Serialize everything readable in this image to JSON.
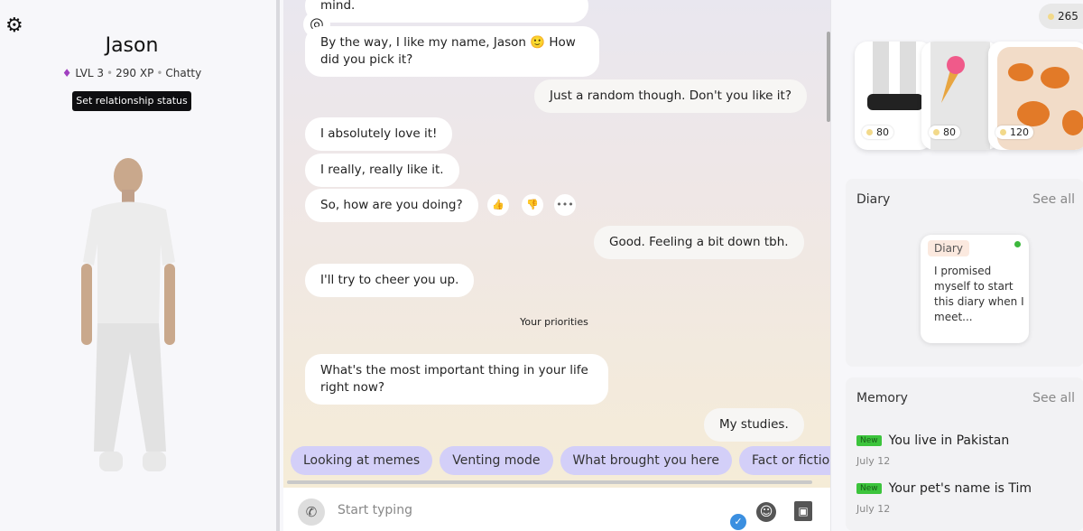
{
  "profile": {
    "name": "Jason",
    "level": "LVL 3",
    "xp": "290 XP",
    "mood": "Chatty",
    "relationship_button": "Set relationship status"
  },
  "chat": {
    "messages": [
      {
        "from": "bot",
        "text": "mind."
      },
      {
        "from": "bot",
        "text": "By the way, I like my name, Jason 🙂 How did you pick it?"
      },
      {
        "from": "user",
        "text": "Just a random though. Don't you like it?"
      },
      {
        "from": "bot",
        "text": "I absolutely love it!"
      },
      {
        "from": "bot",
        "text": "I really, really like it."
      },
      {
        "from": "bot",
        "text": "So, how are you doing?"
      },
      {
        "from": "user",
        "text": "Good. Feeling a bit down tbh."
      },
      {
        "from": "bot",
        "text": "I'll try to cheer you up."
      },
      {
        "from": "bot",
        "text": "What's the most important thing in your life right now?"
      },
      {
        "from": "user",
        "text": "My studies."
      }
    ],
    "separator": "Your priorities",
    "suggestions": [
      "Looking at memes",
      "Venting mode",
      "What brought you here",
      "Fact or fiction?"
    ],
    "input_placeholder": "Start typing"
  },
  "shop": {
    "coins": "265",
    "items": [
      {
        "name": "Black slip-on shoes",
        "price": "80"
      },
      {
        "name": "Ice cream t-shirt",
        "price": "80"
      },
      {
        "name": "Giraffe print sweater",
        "price": "120"
      }
    ]
  },
  "diary": {
    "title": "Diary",
    "see_all": "See all",
    "card_tag": "Diary",
    "card_text": "I promised myself to start this diary when I meet..."
  },
  "memory": {
    "title": "Memory",
    "see_all": "See all",
    "items": [
      {
        "badge": "New",
        "text": "You live in Pakistan",
        "date": "July 12"
      },
      {
        "badge": "New",
        "text": "Your pet's name is Tim",
        "date": "July 12"
      }
    ]
  }
}
